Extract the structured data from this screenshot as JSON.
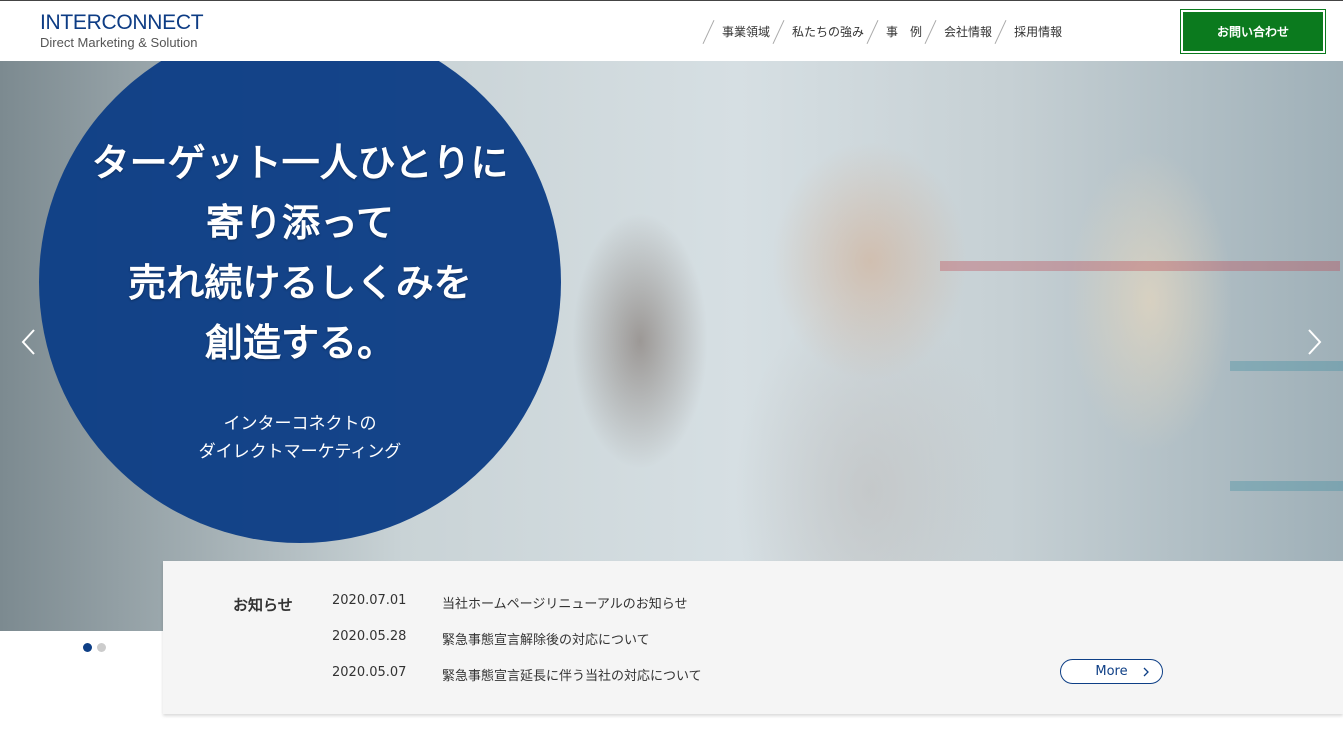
{
  "header": {
    "logo_main": "INTERCONNECT",
    "logo_sub": "Direct Marketing & Solution",
    "nav": [
      "事業領域",
      "私たちの強み",
      "事　例",
      "会社情報",
      "採用情報"
    ],
    "contact_label": "お問い合わせ"
  },
  "hero": {
    "headline": [
      "ターゲット一人ひとりに",
      "寄り添って",
      "売れ続けるしくみを",
      "創造する。"
    ],
    "subline": [
      "インターコネクトの",
      "ダイレクトマーケティング"
    ],
    "slide_count": 2,
    "active_slide": 1
  },
  "news": {
    "title": "お知らせ",
    "items": [
      {
        "date": "2020.07.01",
        "text": "当社ホームページリニューアルのお知らせ"
      },
      {
        "date": "2020.05.28",
        "text": "緊急事態宣言解除後の対応について"
      },
      {
        "date": "2020.05.07",
        "text": "緊急事態宣言延長に伴う当社の対応について"
      }
    ],
    "more_label": "More"
  },
  "colors": {
    "brand_blue": "#0e3f86",
    "contact_green": "#0b7a1e",
    "news_bg": "#f5f5f5"
  },
  "icons": {
    "prev": "chevron-left-icon",
    "next": "chevron-right-icon",
    "more": "chevron-right-icon"
  }
}
